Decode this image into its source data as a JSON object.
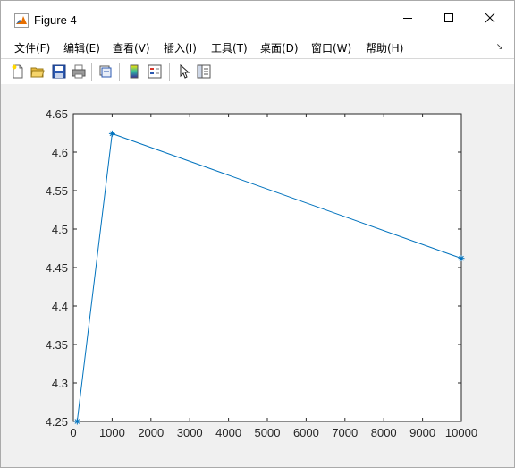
{
  "window": {
    "title": "Figure 4"
  },
  "menu": {
    "items": [
      {
        "label": "文件(F)"
      },
      {
        "label": "编辑(E)"
      },
      {
        "label": "查看(V)"
      },
      {
        "label": "插入(I)"
      },
      {
        "label": "工具(T)"
      },
      {
        "label": "桌面(D)"
      },
      {
        "label": "窗口(W)"
      },
      {
        "label": "帮助(H)"
      }
    ]
  },
  "toolbar": {
    "buttons": [
      "new-figure-icon",
      "open-file-icon",
      "save-icon",
      "print-icon",
      "link-plot-icon",
      "colorbar-icon",
      "legend-icon",
      "pointer-icon",
      "property-editor-icon"
    ]
  },
  "colors": {
    "line": "#0072BD",
    "axes_bg": "#ffffff",
    "figure_bg": "#f0f0f0"
  },
  "chart_data": {
    "type": "line",
    "title": "",
    "xlabel": "",
    "ylabel": "",
    "x": [
      100,
      1000,
      10000
    ],
    "series": [
      {
        "values": [
          4.25,
          4.624,
          4.462
        ],
        "marker": "*"
      }
    ],
    "xlim": [
      0,
      10000
    ],
    "ylim": [
      4.25,
      4.65
    ],
    "xticks": [
      0,
      1000,
      2000,
      3000,
      4000,
      5000,
      6000,
      7000,
      8000,
      9000,
      10000
    ],
    "yticks": [
      4.25,
      4.3,
      4.35,
      4.4,
      4.45,
      4.5,
      4.55,
      4.6,
      4.65
    ],
    "xtick_labels": [
      "0",
      "1000",
      "2000",
      "3000",
      "4000",
      "5000",
      "6000",
      "7000",
      "8000",
      "9000",
      "10000"
    ],
    "ytick_labels": [
      "4.25",
      "4.3",
      "4.35",
      "4.4",
      "4.45",
      "4.5",
      "4.55",
      "4.6",
      "4.65"
    ],
    "grid": false,
    "legend": "none"
  }
}
